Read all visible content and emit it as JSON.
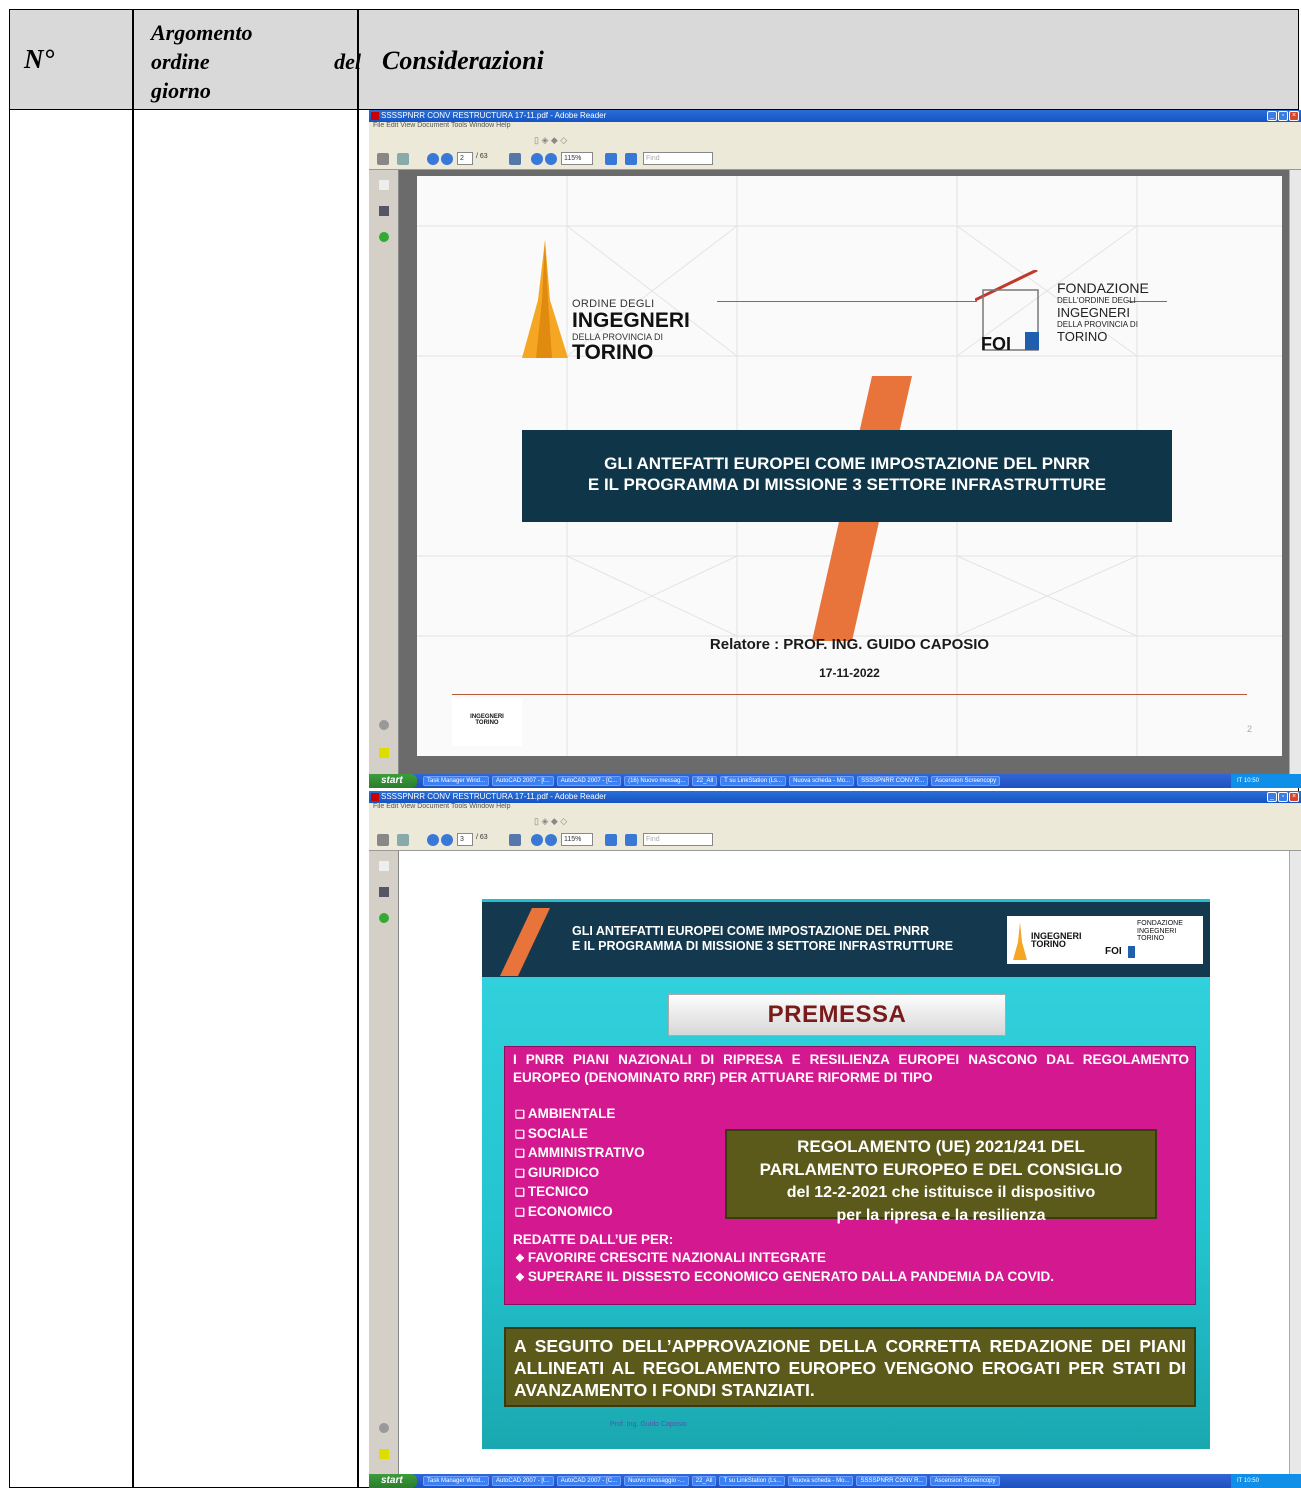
{
  "header": {
    "col_num": "N°",
    "col_arg_line1": "Argomento",
    "col_arg_line2a": "ordine",
    "col_arg_line2b": "del",
    "col_arg_line3": "giorno",
    "col_cons": "Considerazioni"
  },
  "window1": {
    "title": "SSSSPNRR CONV RESTRUCTURA 17-11.pdf - Adobe Reader",
    "menu": "File   Edit   View   Document   Tools   Window   Help",
    "page_box": "2",
    "page_total": "/ 63",
    "zoom": "115%",
    "find": "Find"
  },
  "window2": {
    "title": "SSSSPNRR CONV RESTRUCTURA 17-11.pdf - Adobe Reader",
    "menu": "File   Edit   View   Document   Tools   Window   Help",
    "page_box": "3",
    "page_total": "/ 63",
    "zoom": "115%",
    "find": "Find"
  },
  "taskbar": {
    "start": "start",
    "tasks": [
      "Task Manager Wind...",
      "AutoCAD 2007 - [t...",
      "AutoCAD 2007 - [C...",
      "(16) Nuovo messag...",
      "22_All",
      "T su LinkStation (Ls...",
      "Nuova scheda - Mo...",
      "SSSSPNRR CONV R...",
      "Ascension Screencopy"
    ],
    "tasks2": [
      "Task Manager Wind...",
      "AutoCAD 2007 - [t...",
      "AutoCAD 2007 - [C...",
      "Nuovo messaggio -...",
      "22_All",
      "T su LinkStation (Ls...",
      "Nuova scheda - Mo...",
      "SSSSPNRR CONV R...",
      "Ascension Screencopy"
    ],
    "tray": "IT   10:50"
  },
  "slide1": {
    "logo_left_small": "ORDINE DEGLI",
    "logo_left_big1": "INGEGNERI",
    "logo_left_tiny": "DELLA PROVINCIA DI",
    "logo_left_big2": "TORINO",
    "logo_right_1": "FONDAZIONE",
    "logo_right_2": "DELL'ORDINE DEGLI",
    "logo_right_3": "INGEGNERI",
    "logo_right_4": "DELLA PROVINCIA DI",
    "logo_right_5": "TORINO",
    "logo_right_foi": "FOI",
    "title_line1": "GLI ANTEFATTI EUROPEI COME IMPOSTAZIONE  DEL PNRR",
    "title_line2": "E IL PROGRAMMA DI MISSIONE 3 SETTORE INFRASTRUTTURE",
    "relatore": "Relatore  :  PROF. ING. GUIDO CAPOSIO",
    "date": "17-11-2022",
    "logo_small_1": "INGEGNERI",
    "logo_small_2": "TORINO",
    "page_number": "2"
  },
  "slide2": {
    "head_line1": "GLI ANTEFATTI EUROPEI COME IMPOSTAZIONE  DEL PNRR",
    "head_line2": "E IL PROGRAMMA DI MISSIONE 3 SETTORE INFRASTRUTTURE",
    "premessa": "PREMESSA",
    "intro": "I PNRR PIANI NAZIONALI DI RIPRESA E RESILIENZA EUROPEI NASCONO DAL REGOLAMENTO EUROPEO  (DENOMINATO RRF) PER ATTUARE RIFORME DI TIPO",
    "types": [
      "AMBIENTALE",
      "SOCIALE",
      "AMMINISTRATIVO",
      "GIURIDICO",
      "TECNICO",
      "ECONOMICO"
    ],
    "reg_line1": "REGOLAMENTO (UE) 2021/241 DEL",
    "reg_line2": "PARLAMENTO EUROPEO E DEL CONSIGLIO",
    "reg_line3": "del 12-2-2021 che istituisce il dispositivo",
    "reg_line4": "per la ripresa e la resilienza",
    "redatte": "REDATTE DALL’UE PER:",
    "points": [
      "FAVORIRE CRESCITE NAZIONALI INTEGRATE",
      "SUPERARE IL DISSESTO ECONOMICO GENERATO DALLA PANDEMIA DA COVID."
    ],
    "green": "A SEGUITO DELL’APPROVAZIONE  DELLA CORRETTA REDAZIONE DEI PIANI ALLINEATI AL REGOLAMENTO EUROPEO  VENGONO EROGATI  PER STATI DI AVANZAMENTO I FONDI STANZIATI.",
    "footer": "Prof. Ing. Guido Caposio",
    "logo_a": "INGEGNERI",
    "logo_a2": "TORINO",
    "logo_b1": "FONDAZIONE",
    "logo_b2": "INGEGNERI",
    "logo_b3": "TORINO",
    "logo_foi": "FOI"
  }
}
